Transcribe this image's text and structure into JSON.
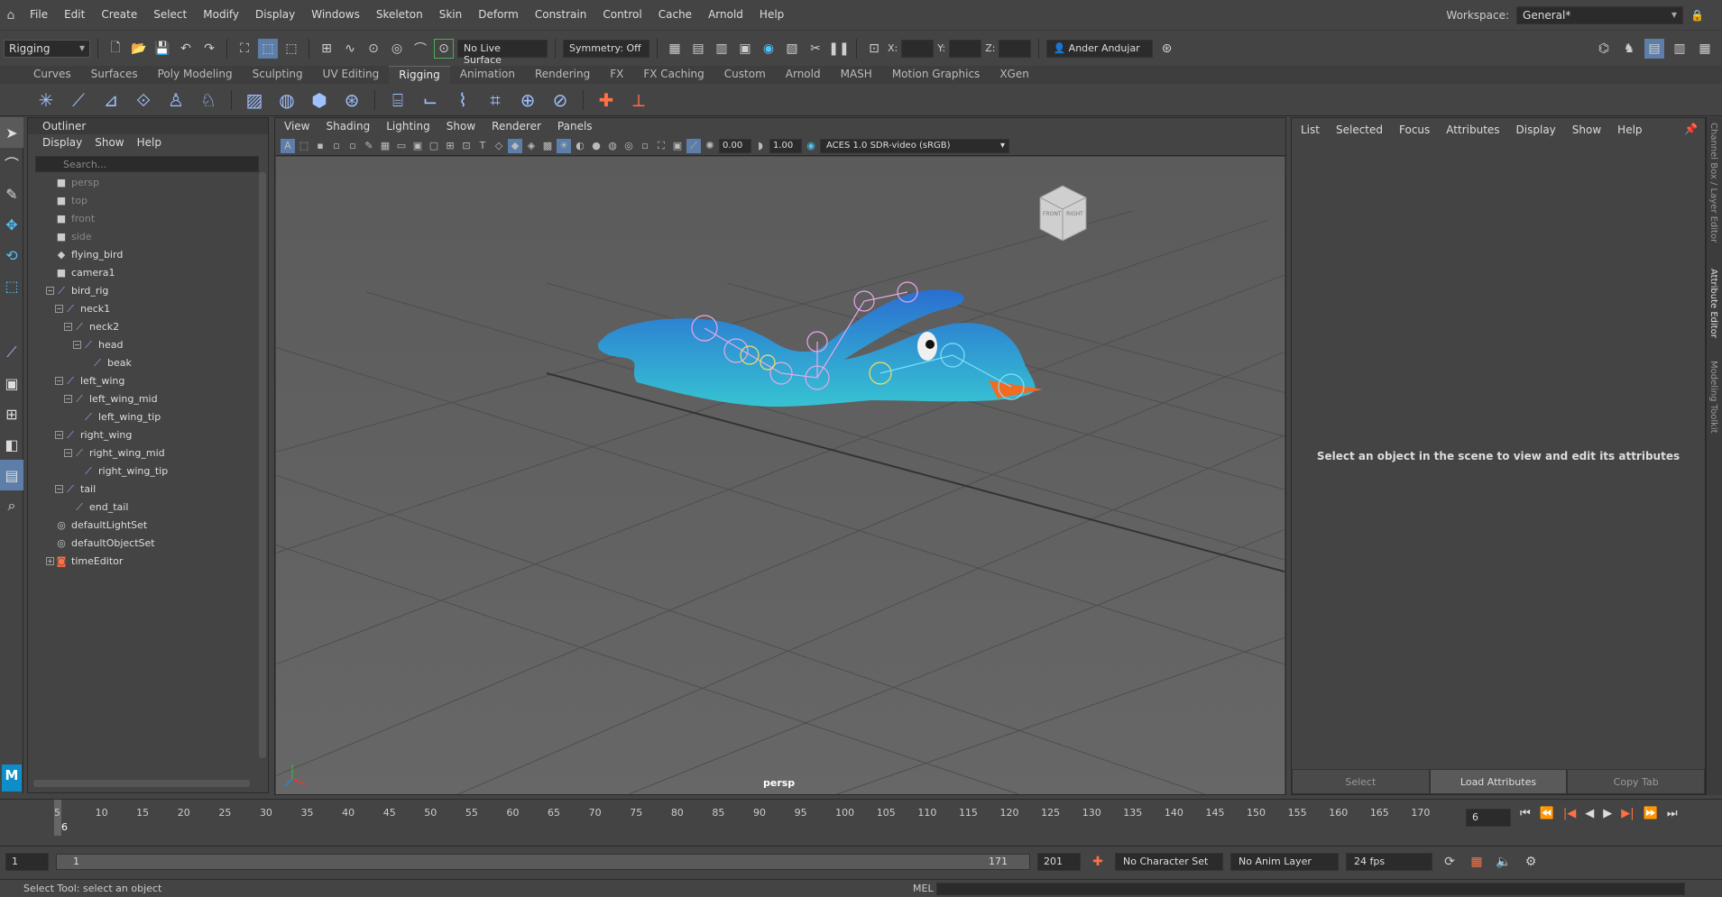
{
  "menubar": {
    "items": [
      "File",
      "Edit",
      "Create",
      "Select",
      "Modify",
      "Display",
      "Windows",
      "Skeleton",
      "Skin",
      "Deform",
      "Constrain",
      "Control",
      "Cache",
      "Arnold",
      "Help"
    ],
    "workspace_label": "Workspace:",
    "workspace_value": "General*"
  },
  "statusline": {
    "mode": "Rigging",
    "live_surface": "No Live Surface",
    "symmetry": "Symmetry: Off",
    "x_label": "X:",
    "y_label": "Y:",
    "z_label": "Z:",
    "user": "Ander Andujar"
  },
  "shelf": {
    "tabs": [
      "Curves",
      "Surfaces",
      "Poly Modeling",
      "Sculpting",
      "UV Editing",
      "Rigging",
      "Animation",
      "Rendering",
      "FX",
      "FX Caching",
      "Custom",
      "Arnold",
      "MASH",
      "Motion Graphics",
      "XGen"
    ],
    "active": "Rigging"
  },
  "outliner": {
    "title": "Outliner",
    "menus": [
      "Display",
      "Show",
      "Help"
    ],
    "search_placeholder": "Search...",
    "items": [
      {
        "label": "persp",
        "icon": "camera-icon",
        "dim": true
      },
      {
        "label": "top",
        "icon": "camera-icon",
        "dim": true
      },
      {
        "label": "front",
        "icon": "camera-icon",
        "dim": true
      },
      {
        "label": "side",
        "icon": "camera-icon",
        "dim": true
      },
      {
        "label": "flying_bird",
        "icon": "mesh-icon",
        "dim": false
      },
      {
        "label": "camera1",
        "icon": "camera-icon",
        "dim": false
      },
      {
        "label": "bird_rig",
        "icon": "joint-icon",
        "dim": false
      },
      {
        "label": "neck1",
        "icon": "joint-icon",
        "dim": false
      },
      {
        "label": "neck2",
        "icon": "joint-icon",
        "dim": false
      },
      {
        "label": "head",
        "icon": "joint-icon",
        "dim": false
      },
      {
        "label": "beak",
        "icon": "joint-icon",
        "dim": false
      },
      {
        "label": "left_wing",
        "icon": "joint-icon",
        "dim": false
      },
      {
        "label": "left_wing_mid",
        "icon": "joint-icon",
        "dim": false
      },
      {
        "label": "left_wing_tip",
        "icon": "joint-icon",
        "dim": false
      },
      {
        "label": "right_wing",
        "icon": "joint-icon",
        "dim": false
      },
      {
        "label": "right_wing_mid",
        "icon": "joint-icon",
        "dim": false
      },
      {
        "label": "right_wing_tip",
        "icon": "joint-icon",
        "dim": false
      },
      {
        "label": "tail",
        "icon": "joint-icon",
        "dim": false
      },
      {
        "label": "end_tail",
        "icon": "joint-icon",
        "dim": false
      },
      {
        "label": "defaultLightSet",
        "icon": "set-icon",
        "dim": false
      },
      {
        "label": "defaultObjectSet",
        "icon": "set-icon",
        "dim": false
      },
      {
        "label": "timeEditor",
        "icon": "time-editor-icon",
        "dim": false
      }
    ]
  },
  "viewport": {
    "menus": [
      "View",
      "Shading",
      "Lighting",
      "Show",
      "Renderer",
      "Panels"
    ],
    "exposure": "0.00",
    "gamma": "1.00",
    "color_space": "ACES 1.0 SDR-video (sRGB)",
    "camera_label": "persp",
    "view_cube_front": "FRONT",
    "view_cube_right": "RIGHT"
  },
  "attribute_editor": {
    "menus": [
      "List",
      "Selected",
      "Focus",
      "Attributes",
      "Display",
      "Show",
      "Help"
    ],
    "message": "Select an object in the scene to view and edit its attributes",
    "buttons": [
      "Select",
      "Load Attributes",
      "Copy Tab"
    ],
    "side_tabs": [
      "Channel Box / Layer Editor",
      "Attribute Editor",
      "Modeling Toolkit"
    ]
  },
  "timeline": {
    "tick_labels": [
      "5",
      "10",
      "15",
      "20",
      "25",
      "30",
      "35",
      "40",
      "45",
      "50",
      "55",
      "60",
      "65",
      "70",
      "75",
      "80",
      "85",
      "90",
      "95",
      "100",
      "105",
      "110",
      "115",
      "120",
      "125",
      "130",
      "135",
      "140",
      "145",
      "150",
      "155",
      "160",
      "165",
      "170"
    ],
    "current_frame_marker": "6",
    "current_frame": "6"
  },
  "range": {
    "start": "1",
    "inner_start": "1",
    "inner_end": "171",
    "end": "201",
    "character_set": "No Character Set",
    "anim_layer": "No Anim Layer",
    "fps": "24 fps"
  },
  "status": {
    "help_line": "Select Tool: select an object",
    "mel_label": "MEL"
  }
}
